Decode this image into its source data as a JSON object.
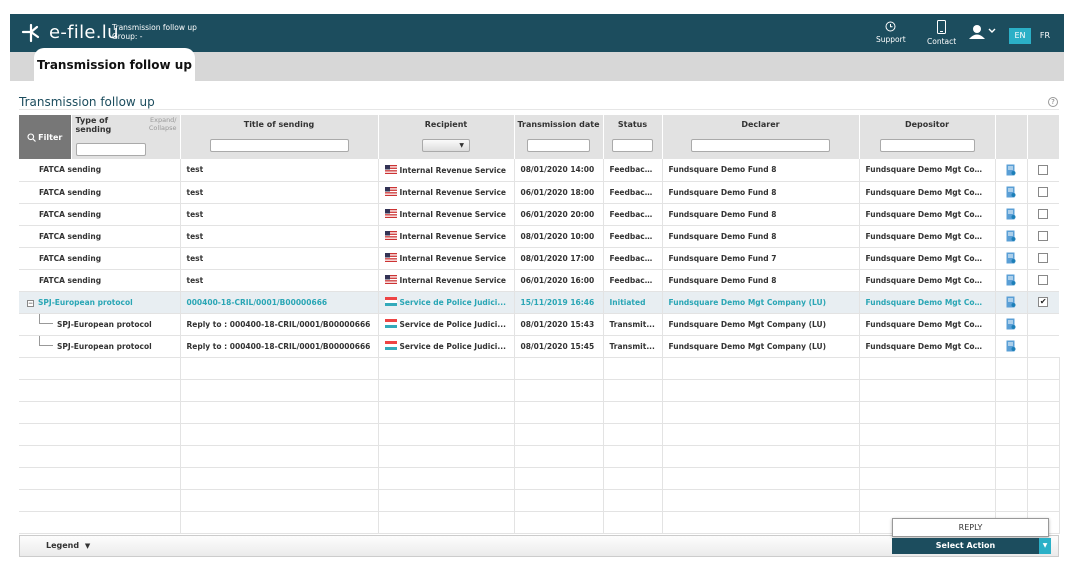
{
  "header": {
    "logo_text": "e-file.lu",
    "app_title": "Transmission follow up",
    "group": "Group: -",
    "support": "Support",
    "contact": "Contact",
    "lang_en": "EN",
    "lang_fr": "FR"
  },
  "tabs": {
    "active": "Transmission follow up"
  },
  "section": {
    "title": "Transmission follow up",
    "help": "?"
  },
  "grid": {
    "filter": "Filter",
    "columns": {
      "type": "Type of sending",
      "expand": "Expand/ Collapse",
      "title": "Title of sending",
      "recipient": "Recipient",
      "date": "Transmission date",
      "status": "Status",
      "declarer": "Declarer",
      "depositor": "Depositor"
    },
    "dropdown_arrow": "▼",
    "rows": [
      {
        "type": "FATCA sending",
        "title": "test",
        "recipient": "Internal Revenue Service",
        "date": "08/01/2020 14:00",
        "status": "Feedback...",
        "declarer": "Fundsquare Demo Fund 8",
        "depositor": "Fundsquare Demo Mgt Compa...",
        "checked": ""
      },
      {
        "type": "FATCA sending",
        "title": "test",
        "recipient": "Internal Revenue Service",
        "date": "06/01/2020 18:00",
        "status": "Feedback...",
        "declarer": "Fundsquare Demo Fund 8",
        "depositor": "Fundsquare Demo Mgt Compa...",
        "checked": ""
      },
      {
        "type": "FATCA sending",
        "title": "test",
        "recipient": "Internal Revenue Service",
        "date": "06/01/2020 20:00",
        "status": "Feedback...",
        "declarer": "Fundsquare Demo Fund 8",
        "depositor": "Fundsquare Demo Mgt Compa...",
        "checked": ""
      },
      {
        "type": "FATCA sending",
        "title": "test",
        "recipient": "Internal Revenue Service",
        "date": "08/01/2020 10:00",
        "status": "Feedback...",
        "declarer": "Fundsquare Demo Fund 8",
        "depositor": "Fundsquare Demo Mgt Compa...",
        "checked": ""
      },
      {
        "type": "FATCA sending",
        "title": "test",
        "recipient": "Internal Revenue Service",
        "date": "08/01/2020 17:00",
        "status": "Feedback...",
        "declarer": "Fundsquare Demo Fund 7",
        "depositor": "Fundsquare Demo Mgt Compa...",
        "checked": ""
      },
      {
        "type": "FATCA sending",
        "title": "test",
        "recipient": "Internal Revenue Service",
        "date": "06/01/2020 16:00",
        "status": "Feedback...",
        "declarer": "Fundsquare Demo Fund 8",
        "depositor": "Fundsquare Demo Mgt Compa...",
        "checked": ""
      },
      {
        "type": "SPJ-European protocol",
        "title": "000400-18-CRIL/0001/B00000666",
        "recipient": "Service de Police Judici...",
        "date": "15/11/2019 16:46",
        "status": "Initiated",
        "declarer": "Fundsquare Demo Mgt Company (LU)",
        "depositor": "Fundsquare Demo Mgt Compa...",
        "checked": "✔"
      },
      {
        "type": "SPJ-European protocol",
        "title": "Reply to : 000400-18-CRIL/0001/B00000666",
        "recipient": "Service de Police Judici...",
        "date": "08/01/2020 15:43",
        "status": "Transmit...",
        "declarer": "Fundsquare Demo Mgt Company (LU)",
        "depositor": "Fundsquare Demo Mgt Compa...",
        "checked": ""
      },
      {
        "type": "SPJ-European protocol",
        "title": "Reply to : 000400-18-CRIL/0001/B00000666",
        "recipient": "Service de Police Judici...",
        "date": "08/01/2020 15:45",
        "status": "Transmit...",
        "declarer": "Fundsquare Demo Mgt Company (LU)",
        "depositor": "Fundsquare Demo Mgt Compa...",
        "checked": ""
      }
    ]
  },
  "footer": {
    "legend": "Legend",
    "legend_arrow": "▼",
    "popup_item": "REPLY",
    "select_action": "Select Action",
    "action_arrow": "▼"
  },
  "colors": {
    "header_bg": "#1c4d5e",
    "accent": "#2bb0c7",
    "selected_text": "#2aa6b5"
  }
}
